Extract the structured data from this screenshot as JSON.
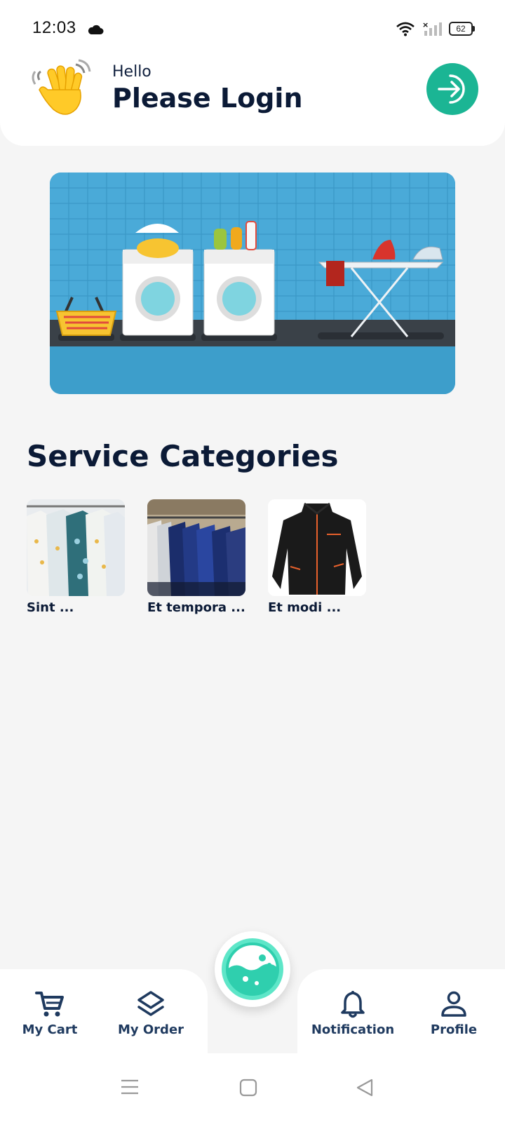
{
  "status_bar": {
    "time": "12:03",
    "battery": "62"
  },
  "header": {
    "greeting": "Hello",
    "title": "Please Login"
  },
  "section": {
    "title": "Service Categories"
  },
  "categories": [
    {
      "label": "Sint ...",
      "icon": "clothing-rack-photo"
    },
    {
      "label": "Et tempora ...",
      "icon": "suit-rack-photo"
    },
    {
      "label": "Et modi ...",
      "icon": "black-jacket-photo"
    }
  ],
  "nav": {
    "cart": "My Cart",
    "order": "My Order",
    "notification": "Notification",
    "profile": "Profile"
  },
  "colors": {
    "accent": "#1bb594",
    "text_dark": "#0b1a36",
    "nav_text": "#1f3a5f"
  }
}
